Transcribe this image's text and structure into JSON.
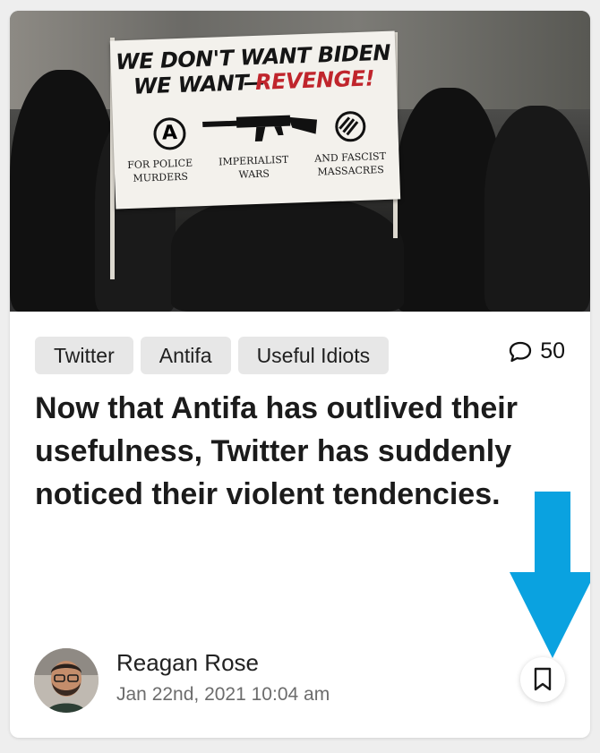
{
  "post": {
    "banner_text": {
      "line1": "WE DON'T WANT BIDEN—",
      "line2_prefix": "WE WANT ",
      "line2_highlight": "REVENGE!",
      "footer": [
        [
          "FOR POLICE",
          "MURDERS"
        ],
        [
          "IMPERIALIST",
          "WARS"
        ],
        [
          "AND FASCIST",
          "MASSACRES"
        ]
      ]
    },
    "tags": [
      "Twitter",
      "Antifa",
      "Useful Idiots"
    ],
    "comment_count": "50",
    "title": "Now that Antifa has outlived their usefulness, Twitter has suddenly noticed their violent tendencies.",
    "author": {
      "name": "Reagan Rose",
      "date": "Jan 22nd, 2021 10:04 am"
    }
  },
  "icons": {
    "comment": "speech-bubble-icon",
    "bookmark": "bookmark-icon",
    "annotation": "down-arrow-icon"
  },
  "colors": {
    "arrow": "#0aa2e0",
    "tag_bg": "#e7e7e7",
    "banner_red": "#c0252c"
  }
}
